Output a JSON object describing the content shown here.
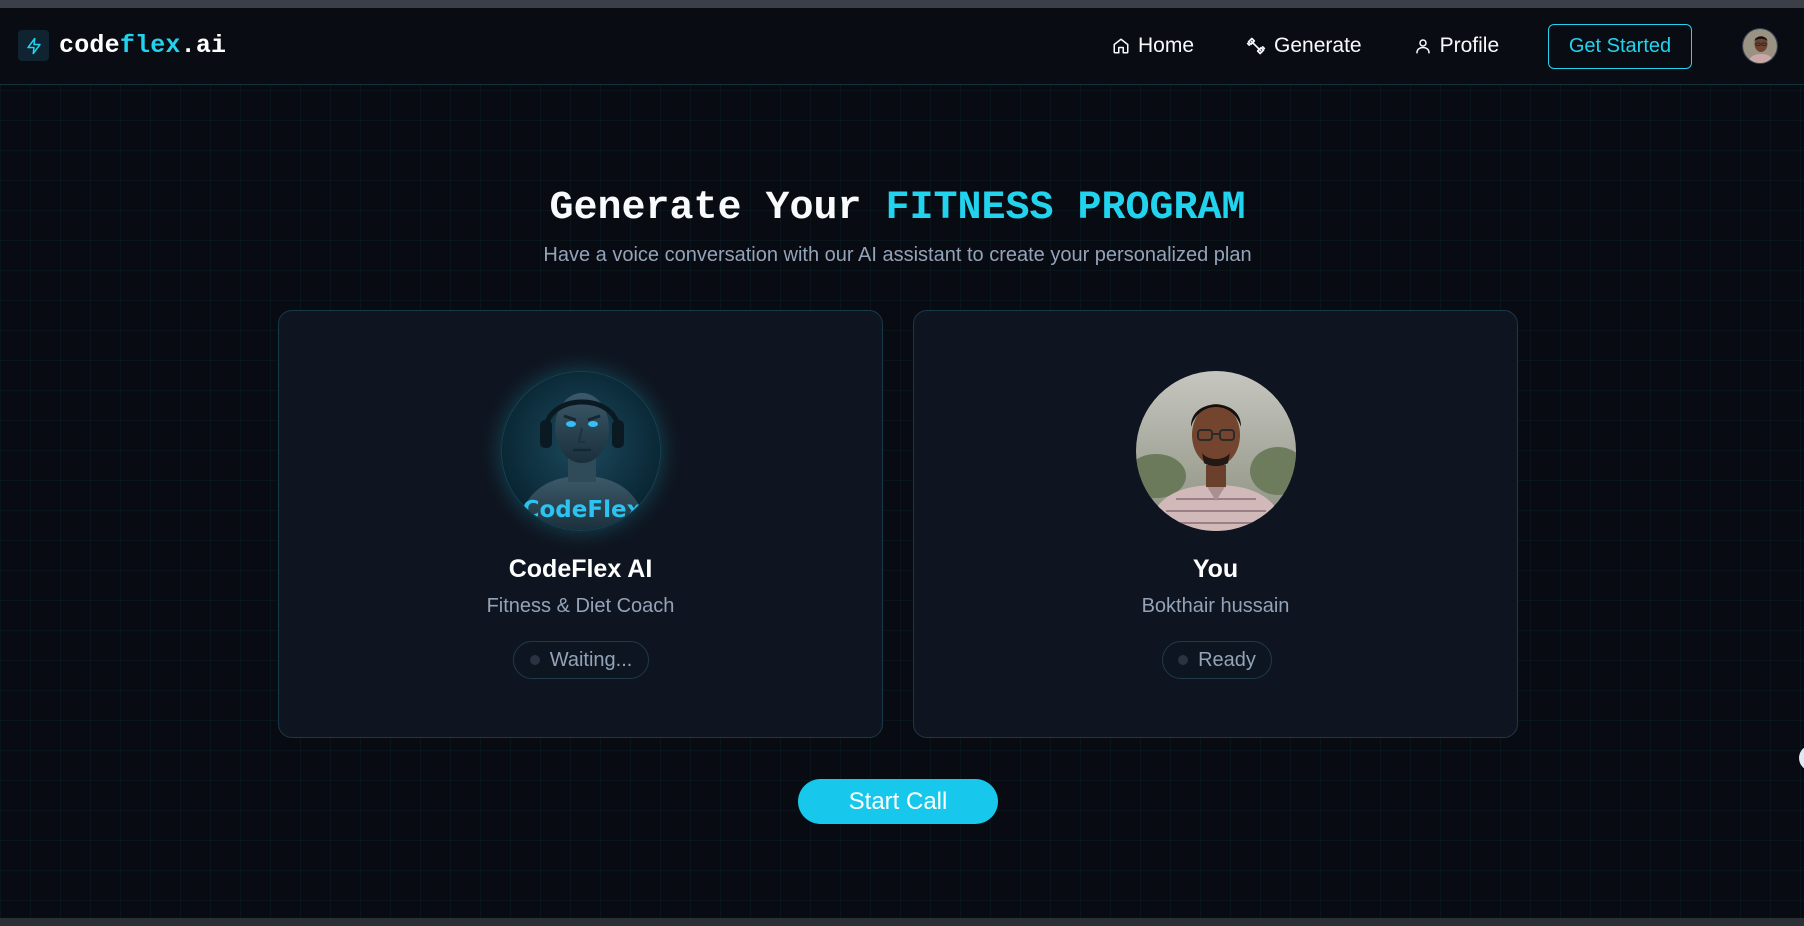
{
  "logo": {
    "name_part1": "code",
    "name_accent": "flex",
    "name_suffix": ".ai",
    "icon": "lightning-bolt-icon"
  },
  "nav": {
    "items": [
      {
        "label": "Home",
        "icon": "home-icon"
      },
      {
        "label": "Generate",
        "icon": "dumbbell-icon"
      },
      {
        "label": "Profile",
        "icon": "user-icon"
      }
    ],
    "cta_label": "Get Started"
  },
  "hero": {
    "title_part1": "Generate Your ",
    "title_accent": "FITNESS PROGRAM",
    "subtitle": "Have a voice conversation with our AI assistant to create your personalized plan"
  },
  "ai_card": {
    "avatar_text": "CodeFlex",
    "name": "CodeFlex AI",
    "role": "Fitness & Diet Coach",
    "status": "Waiting..."
  },
  "user_card": {
    "name": "You",
    "role": "Bokthair hussain",
    "status": "Ready"
  },
  "start_call_label": "Start Call",
  "colors": {
    "accent": "#22d3ee",
    "background": "#080b12",
    "card": "#0f1520",
    "muted": "#94a3b8"
  }
}
